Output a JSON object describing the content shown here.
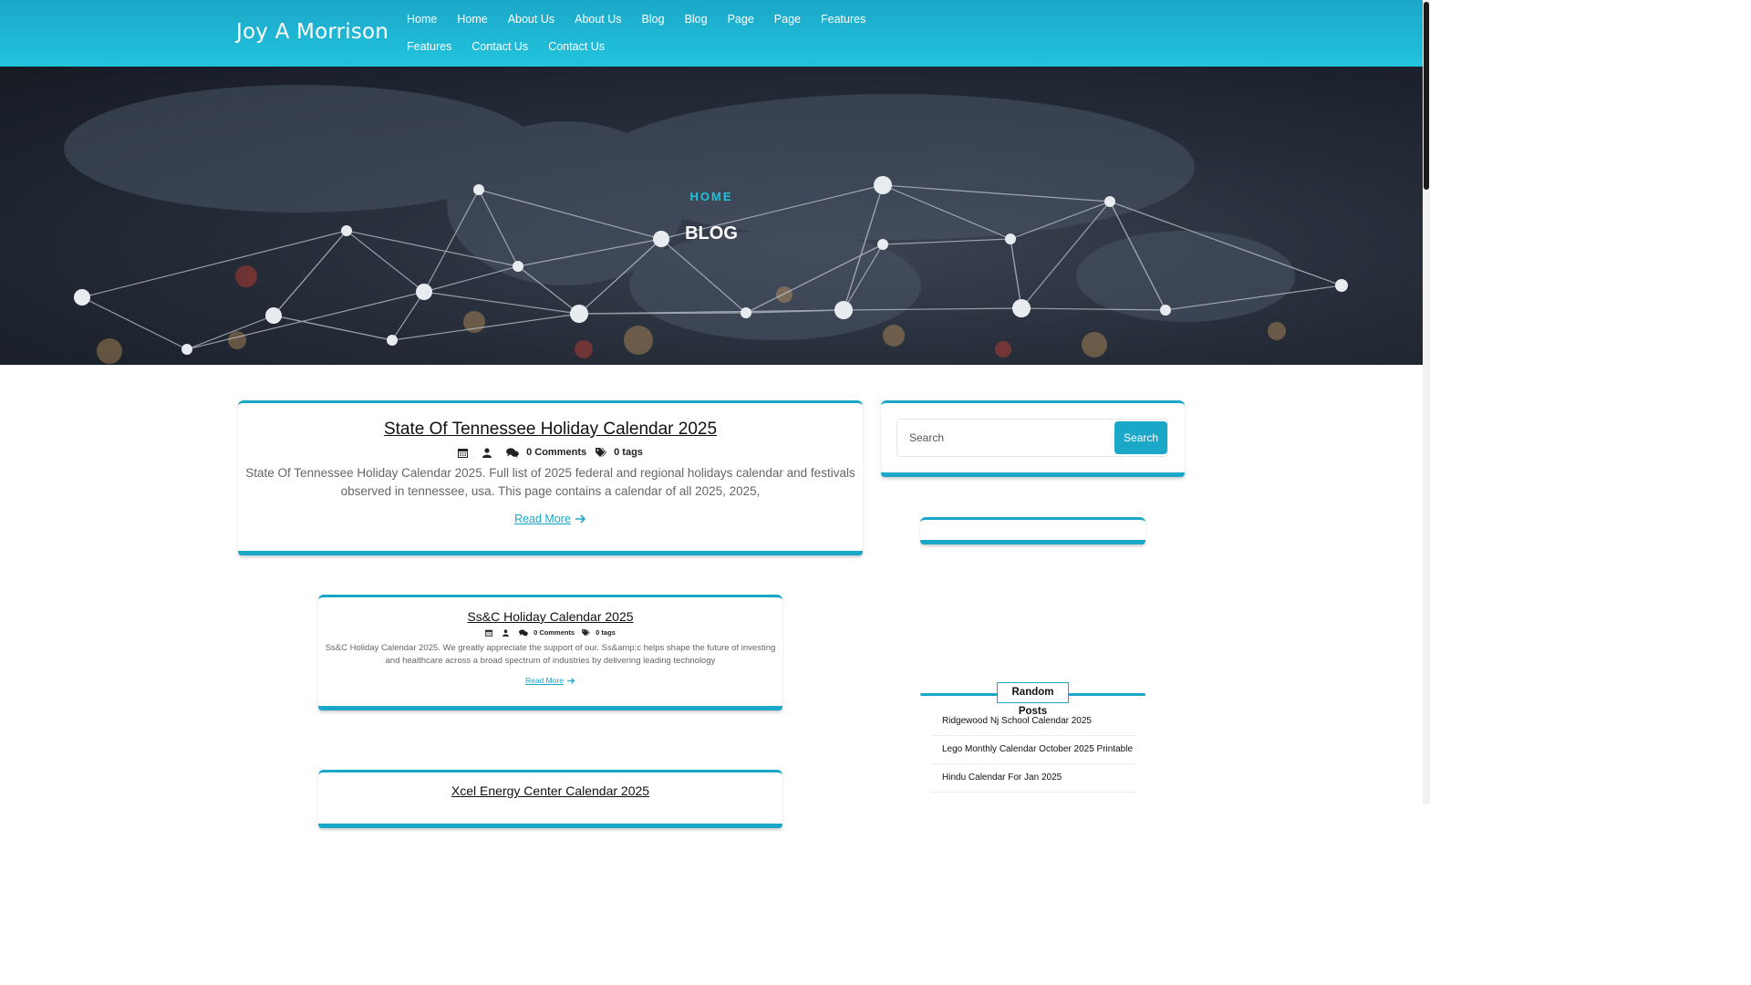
{
  "site": {
    "brand": "Joy A Morrison"
  },
  "nav": {
    "items": [
      "Home",
      "Home",
      "About Us",
      "About Us",
      "Blog",
      "Blog",
      "Page",
      "Page",
      "Features",
      "Features",
      "Contact Us",
      "Contact Us"
    ]
  },
  "hero": {
    "breadcrumb": "HOME",
    "title": "BLOG"
  },
  "posts": [
    {
      "title": "State Of Tennessee Holiday Calendar 2025",
      "comments": "0 Comments",
      "tags": "0 tags",
      "excerpt_line1": "State Of Tennessee Holiday Calendar 2025. Full list of 2025 federal and regional holidays calendar and festivals",
      "excerpt_line2": "observed in tennessee, usa. This page contains a calendar of all 2025, 2025,",
      "read_more": "Read More"
    },
    {
      "title": "Ss&C Holiday Calendar 2025",
      "comments": "0 Comments",
      "tags": "0 tags",
      "excerpt_line1": "Ss&C Holiday Calendar 2025. We greatly appreciate the support of our. Ss&amp;c helps shape the future of investing",
      "excerpt_line2": "and healthcare across a broad spectrum of industries by delivering leading technology",
      "read_more": "Read More"
    },
    {
      "title": "Xcel Energy Center Calendar 2025"
    }
  ],
  "sidebar": {
    "search": {
      "placeholder": "Search",
      "button": "Search"
    },
    "random_posts": {
      "heading": "Random Posts",
      "items": [
        "Ridgewood Nj School Calendar 2025",
        "Lego Monthly Calendar October 2025 Printable",
        "Hindu Calendar For Jan 2025"
      ]
    }
  },
  "colors": {
    "accent": "#1ba7c8",
    "header_light": "#22c3dd"
  }
}
